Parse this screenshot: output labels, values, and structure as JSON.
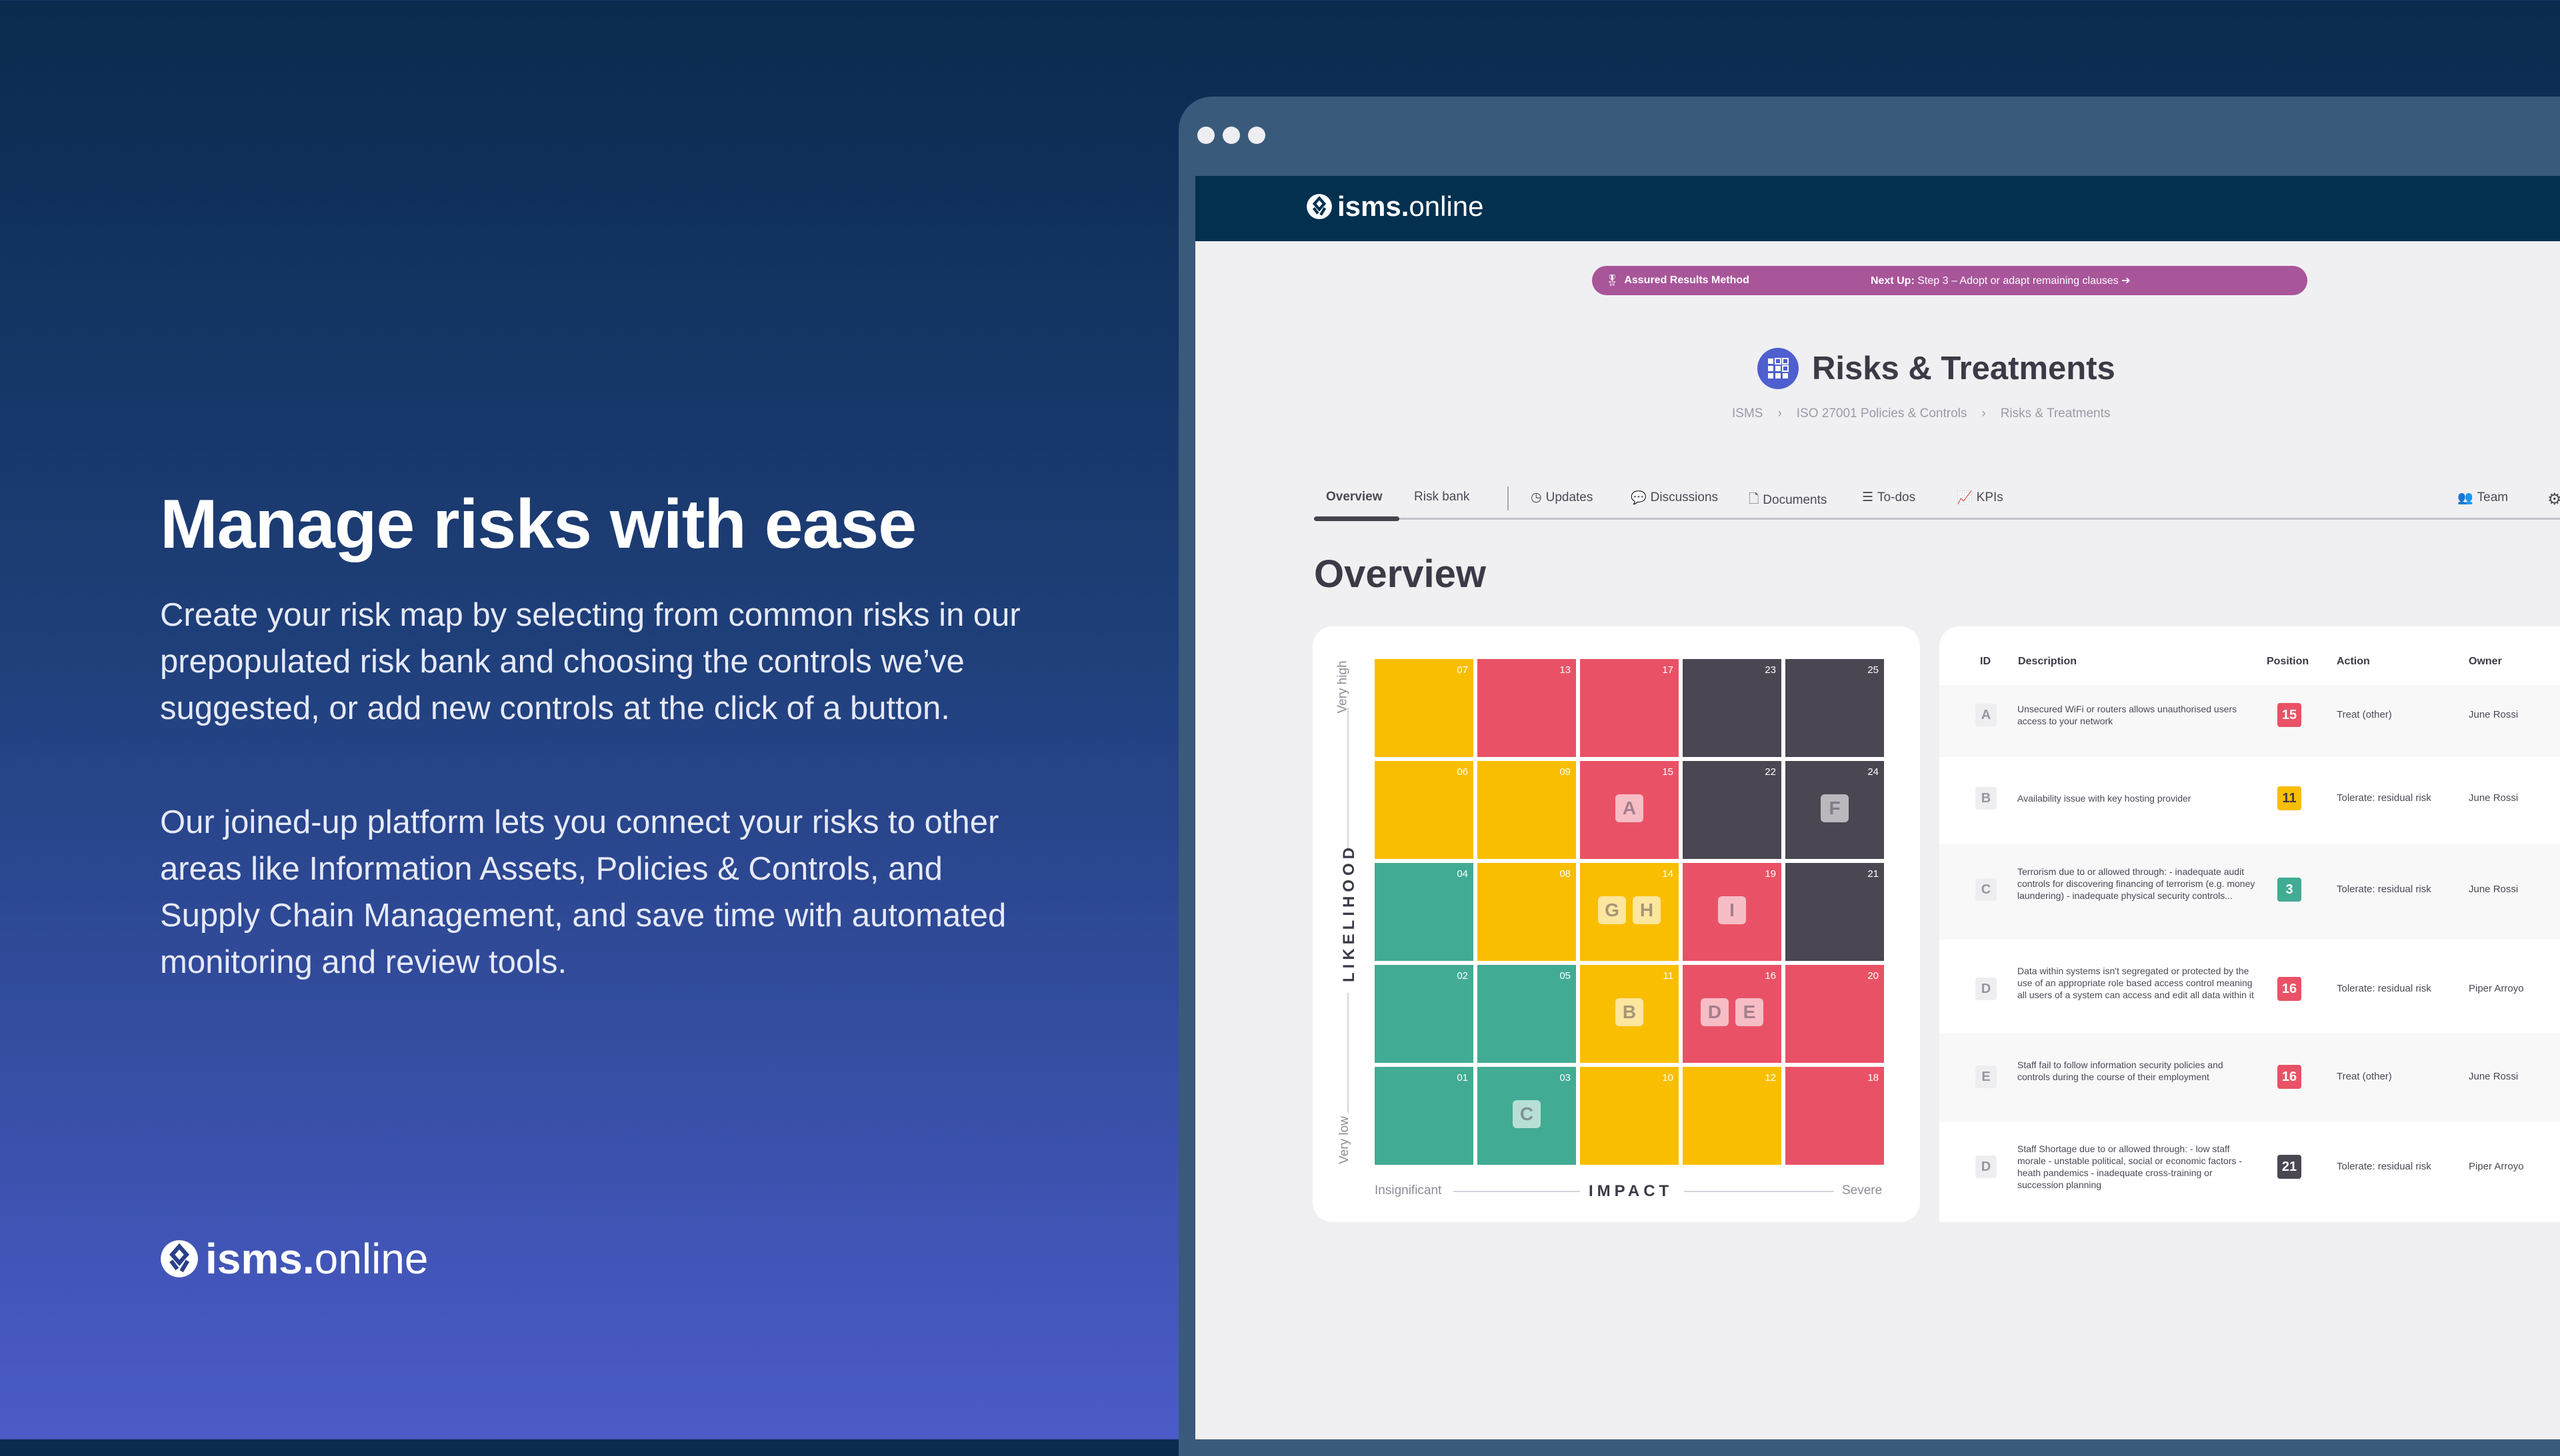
{
  "hero": {
    "title": "Manage risks with ease",
    "p1": "Create your risk map by selecting from common risks in our prepopulated risk bank and choosing the controls we’ve suggested, or add new controls at the click of a button.",
    "p2": "Our joined-up platform lets you connect your risks to other areas like Information Assets, Policies & Controls, and Supply Chain Management, and save time with automated monitoring and review tools."
  },
  "brand": {
    "bold": "isms.",
    "light": "online"
  },
  "banner": {
    "label": "Assured Results Method",
    "next_label": "Next Up:",
    "next_text": "Step 3 – Adopt or adapt remaining clauses"
  },
  "page": {
    "title": "Risks & Treatments",
    "breadcrumb": [
      "ISMS",
      "ISO 27001 Policies & Controls",
      "Risks & Treatments"
    ],
    "heading": "Overview"
  },
  "tabs": [
    {
      "label": "Overview",
      "icon": ""
    },
    {
      "label": "Risk bank",
      "icon": ""
    },
    {
      "label": "Updates",
      "icon": "clock-icon"
    },
    {
      "label": "Discussions",
      "icon": "chat-icon"
    },
    {
      "label": "Documents",
      "icon": "document-icon"
    },
    {
      "label": "To-dos",
      "icon": "list-icon"
    },
    {
      "label": "KPIs",
      "icon": "chart-icon"
    }
  ],
  "team_label": "Team",
  "matrix": {
    "y_high": "Very high",
    "y_low": "Very low",
    "y_title": "LIKELIHOOD",
    "x_low": "Insignificant",
    "x_high": "Severe",
    "x_title": "IMPACT",
    "colors": {
      "Y": "#f9be00",
      "R": "#e95266",
      "K": "#4a4652",
      "G": "#42ab93"
    },
    "rows": [
      [
        {
          "n": "07",
          "c": "Y"
        },
        {
          "n": "13",
          "c": "R"
        },
        {
          "n": "17",
          "c": "R"
        },
        {
          "n": "23",
          "c": "K"
        },
        {
          "n": "25",
          "c": "K"
        }
      ],
      [
        {
          "n": "06",
          "c": "Y"
        },
        {
          "n": "09",
          "c": "Y"
        },
        {
          "n": "15",
          "c": "R",
          "m": [
            "A"
          ]
        },
        {
          "n": "22",
          "c": "K"
        },
        {
          "n": "24",
          "c": "K",
          "m": [
            "F"
          ]
        }
      ],
      [
        {
          "n": "04",
          "c": "G"
        },
        {
          "n": "08",
          "c": "Y"
        },
        {
          "n": "14",
          "c": "Y",
          "m": [
            "G",
            "H"
          ]
        },
        {
          "n": "19",
          "c": "R",
          "m": [
            "I"
          ]
        },
        {
          "n": "21",
          "c": "K"
        }
      ],
      [
        {
          "n": "02",
          "c": "G"
        },
        {
          "n": "05",
          "c": "G"
        },
        {
          "n": "11",
          "c": "Y",
          "m": [
            "B"
          ]
        },
        {
          "n": "16",
          "c": "R",
          "m": [
            "D",
            "E"
          ]
        },
        {
          "n": "20",
          "c": "R"
        }
      ],
      [
        {
          "n": "01",
          "c": "G"
        },
        {
          "n": "03",
          "c": "G",
          "m": [
            "C"
          ]
        },
        {
          "n": "10",
          "c": "Y"
        },
        {
          "n": "12",
          "c": "Y"
        },
        {
          "n": "18",
          "c": "R"
        }
      ]
    ]
  },
  "table": {
    "headers": {
      "id": "ID",
      "desc": "Description",
      "pos": "Position",
      "action": "Action",
      "owner": "Owner"
    },
    "rows": [
      {
        "id": "A",
        "desc": "Unsecured WiFi or routers allows unauthorised users access to your network",
        "pos": "15",
        "c": "R",
        "action": "Treat (other)",
        "owner": "June Rossi"
      },
      {
        "id": "B",
        "desc": "Availability issue with key hosting provider",
        "pos": "11",
        "c": "Y",
        "action": "Tolerate: residual risk",
        "owner": "June Rossi"
      },
      {
        "id": "C",
        "desc": "Terrorism due to or allowed through: - inadequate audit controls for discovering financing of terrorism (e.g. money laundering) - inadequate physical security controls...",
        "pos": "3",
        "c": "G",
        "action": "Tolerate: residual risk",
        "owner": "June Rossi"
      },
      {
        "id": "D",
        "desc": "Data within systems isn't segregated or protected by the use of an appropriate role based access control meaning all users of a system can access and edit all data within it",
        "pos": "16",
        "c": "R",
        "action": "Tolerate: residual risk",
        "owner": "Piper Arroyo"
      },
      {
        "id": "E",
        "desc": "Staff fail to follow information security policies and controls during the course of their employment",
        "pos": "16",
        "c": "R",
        "action": "Treat (other)",
        "owner": "June Rossi"
      },
      {
        "id": "D",
        "desc": "Staff Shortage due to or allowed through: - low staff morale - unstable political, social or economic factors - heath pandemics - inadequate cross-training or succession planning",
        "pos": "21",
        "c": "K",
        "action": "Tolerate: residual risk",
        "owner": "Piper Arroyo"
      }
    ]
  }
}
